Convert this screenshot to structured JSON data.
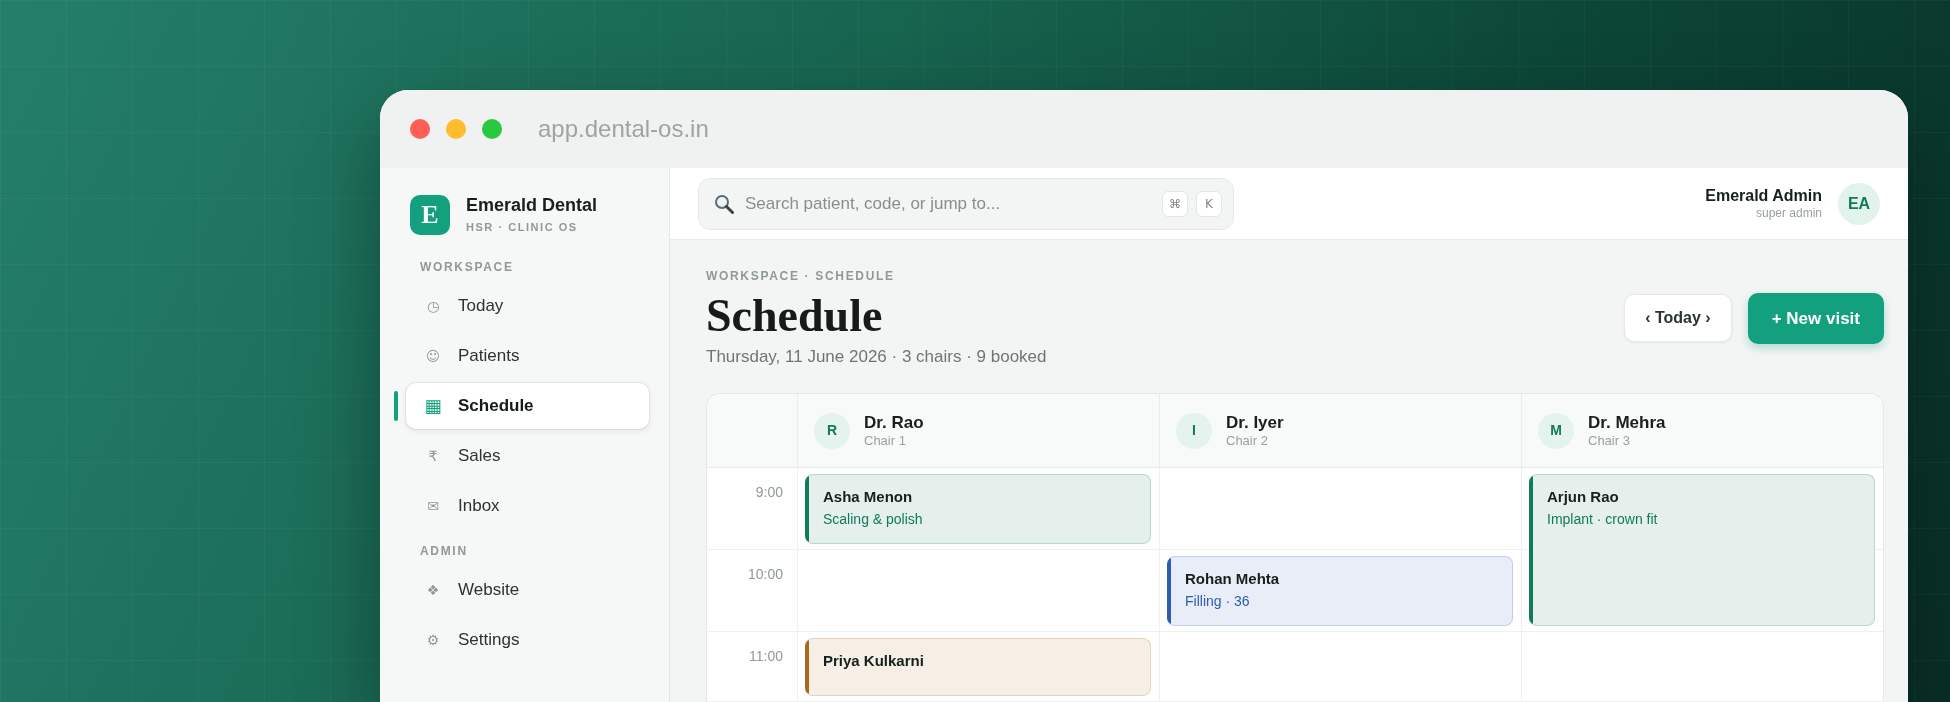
{
  "window": {
    "address": "app.dental-os.in"
  },
  "sidebar": {
    "brand": {
      "logo": "E",
      "name": "Emerald Dental",
      "tagline": "HSR · CLINIC OS"
    },
    "sections": [
      {
        "title": "WORKSPACE",
        "items": [
          {
            "icon": "◷",
            "label": "Today",
            "selected": false
          },
          {
            "icon": "☺",
            "label": "Patients",
            "selected": false
          },
          {
            "icon": "▦",
            "label": "Schedule",
            "selected": true
          },
          {
            "icon": "₹",
            "label": "Sales",
            "selected": false
          },
          {
            "icon": "✉",
            "label": "Inbox",
            "selected": false
          }
        ]
      },
      {
        "title": "ADMIN",
        "items": [
          {
            "icon": "❖",
            "label": "Website",
            "selected": false
          },
          {
            "icon": "⚙",
            "label": "Settings",
            "selected": false
          }
        ]
      }
    ]
  },
  "topbar": {
    "search": {
      "placeholder": "Search patient, code, or jump to...",
      "shortcut": [
        "⌘",
        "K"
      ]
    },
    "user": {
      "name": "Emerald Admin",
      "role": "super admin",
      "initials": "EA"
    }
  },
  "page": {
    "breadcrumb": "WORKSPACE · SCHEDULE",
    "title": "Schedule",
    "subtitle": "Thursday, 11 June 2026 · 3 chairs · 9 booked",
    "actions": [
      {
        "kind": "secondary",
        "label": "‹ Today ›"
      },
      {
        "kind": "primary",
        "label": "+ New visit"
      }
    ]
  },
  "schedule": {
    "chairs": [
      {
        "initial": "R",
        "doctor": "Dr. Rao",
        "chair": "Chair 1"
      },
      {
        "initial": "I",
        "doctor": "Dr. Iyer",
        "chair": "Chair 2"
      },
      {
        "initial": "M",
        "doctor": "Dr. Mehra",
        "chair": "Chair 3"
      }
    ],
    "slots": [
      {
        "time": "9:00",
        "cells": [
          {
            "kind": "visit",
            "patient": "Asha Menon",
            "procedure": "Scaling & polish",
            "color": "#0f7a5c"
          },
          {
            "kind": "free"
          },
          {
            "kind": "visit",
            "patient": "Arjun Rao",
            "procedure": "Implant · crown fit",
            "color": "#0f7a5c"
          }
        ]
      },
      {
        "time": "10:00",
        "cells": [
          {
            "kind": "free"
          },
          {
            "kind": "visit",
            "patient": "Rohan Mehta",
            "procedure": "Filling · 36",
            "color": "#2b5eb3"
          },
          {
            "kind": "continued"
          }
        ]
      },
      {
        "time": "11:00",
        "cells": [
          {
            "kind": "visit",
            "patient": "Priya Kulkarni",
            "color": "#a8691c"
          },
          {
            "kind": "free"
          },
          {
            "kind": "free"
          }
        ]
      }
    ]
  }
}
